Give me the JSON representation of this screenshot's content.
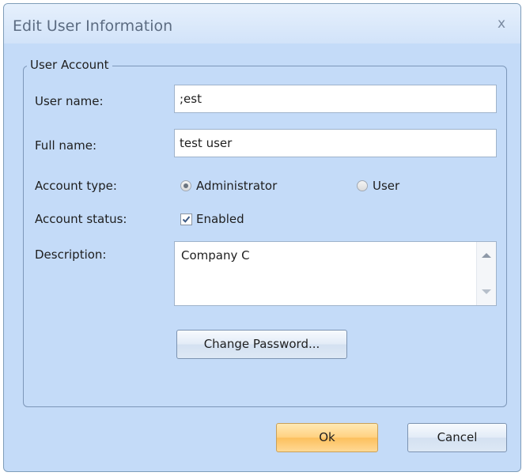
{
  "dialog": {
    "title": "Edit User Information",
    "close_glyph": "x"
  },
  "group": {
    "legend": "User Account"
  },
  "fields": {
    "username_label": "User name:",
    "username_value": ";est",
    "fullname_label": "Full name:",
    "fullname_value": "test user",
    "account_type_label": "Account type:",
    "account_type_options": [
      "Administrator",
      "User"
    ],
    "account_type_selected": "Administrator",
    "account_status_label": "Account status:",
    "enabled_label": "Enabled",
    "enabled_checked": true,
    "description_label": "Description:",
    "description_value": "Company C"
  },
  "buttons": {
    "change_password": "Change Password...",
    "ok": "Ok",
    "cancel": "Cancel"
  },
  "icons": {
    "close": "close-icon",
    "radio_selected": "radio-selected-icon",
    "radio_unselected": "radio-unselected-icon",
    "checkbox": "checkmark-icon",
    "scroll_up": "scroll-up-arrow-icon",
    "scroll_down": "scroll-down-arrow-icon"
  },
  "colors": {
    "window_bg": "#c4dbf8",
    "ok_button": "#fcc05e",
    "border": "#7d97b9"
  }
}
